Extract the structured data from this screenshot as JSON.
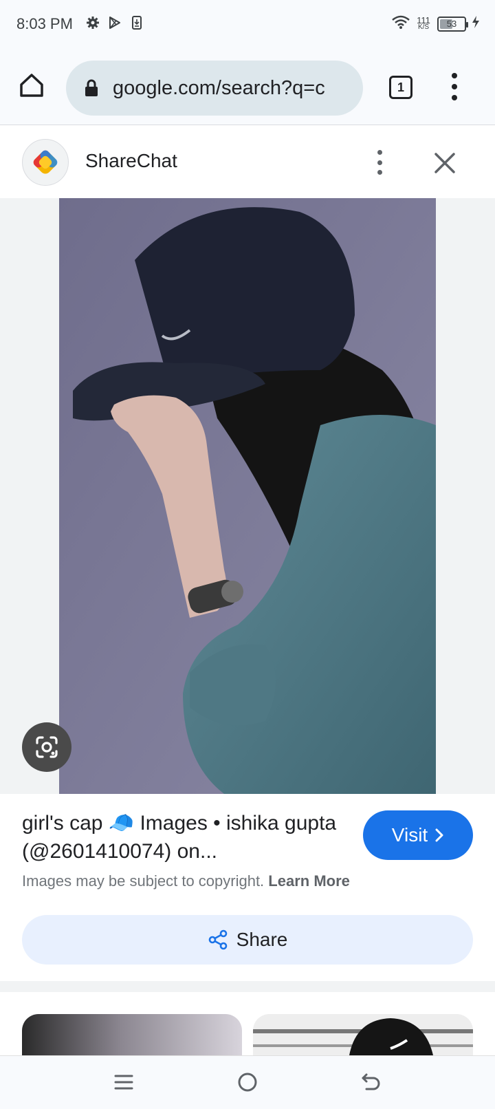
{
  "status_bar": {
    "time": "8:03 PM",
    "net_speed_value": "111",
    "net_speed_unit": "K/S",
    "battery_level": "53",
    "battery_fraction": 0.53
  },
  "browser": {
    "url": "google.com/search?q=c",
    "tab_count": "1"
  },
  "site": {
    "name": "ShareChat"
  },
  "result": {
    "title": "girl's cap 🧢 Images • ishika gupta (@2601410074) on...",
    "visit_label": "Visit",
    "copyright_text": "Images may be subject to copyright.",
    "learn_more_label": "Learn More",
    "share_label": "Share"
  },
  "colors": {
    "accent": "#1a73e8",
    "share_bg": "#e8f0fe",
    "url_bar_bg": "#dde7ec"
  },
  "icons": {
    "home": "home-icon",
    "lock": "lock-icon",
    "tabs": "tab-switcher-icon",
    "menu": "more-vert-icon",
    "close": "close-icon",
    "lens": "google-lens-icon",
    "share": "share-icon",
    "nav_menu": "recent-apps-icon",
    "nav_home": "home-circle-icon",
    "nav_back": "back-icon"
  }
}
